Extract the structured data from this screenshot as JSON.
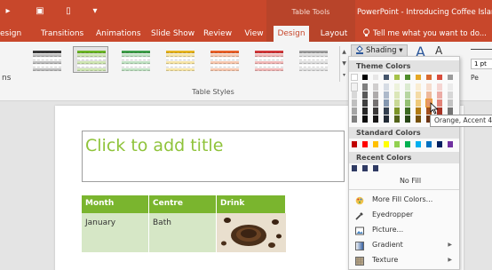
{
  "title_bar": {
    "context_label": "Table Tools",
    "window_title": "PowerPoint - Introducing Coffee Island.p",
    "tell_me": "Tell me what you want to do..."
  },
  "tabs": [
    {
      "label": "esign"
    },
    {
      "label": "Transitions"
    },
    {
      "label": "Animations"
    },
    {
      "label": "Slide Show"
    },
    {
      "label": "Review"
    },
    {
      "label": "View"
    },
    {
      "label": "Design",
      "active": true
    },
    {
      "label": "Layout"
    }
  ],
  "ribbon": {
    "left_cut_label": "ns",
    "group_label": "Table Styles",
    "shading_label": "Shading",
    "pt_value": "1 pt",
    "pen_label": "Pe",
    "table_style_swatches": [
      {
        "header": "#3a3a3a",
        "band": "#bdbdbd"
      },
      {
        "header": "#6bb526",
        "band": "#cfe6b2",
        "selected": true
      },
      {
        "header": "#3f9f4a",
        "band": "#bfe1c2"
      },
      {
        "header": "#e6b420",
        "band": "#f6e4a6"
      },
      {
        "header": "#e9612a",
        "band": "#f7c7ae"
      },
      {
        "header": "#d2383a",
        "band": "#f1b8b7"
      },
      {
        "header": "#a0a0a0",
        "band": "#dcdcdc"
      }
    ]
  },
  "dropdown": {
    "theme_colors_label": "Theme Colors",
    "standard_colors_label": "Standard Colors",
    "recent_colors_label": "Recent Colors",
    "no_fill": "No Fill",
    "tooltip": "Orange, Accent 4, L",
    "theme_top_row": [
      "#ffffff",
      "#000000",
      "#e7e6e6",
      "#44546a",
      "#a5c249",
      "#4f8c2b",
      "#e5a725",
      "#d8692f",
      "#d84c3c",
      "#9b9b9b"
    ],
    "theme_shades": [
      [
        "#f2f2f2",
        "#7f7f7f",
        "#d0cece",
        "#d6dce4",
        "#edf2dc",
        "#dbead0",
        "#faedd2",
        "#f6dccd",
        "#f5d5d2",
        "#ebebeb"
      ],
      [
        "#d8d8d8",
        "#595959",
        "#aeabab",
        "#adb9ca",
        "#dbe6b8",
        "#b7d5a1",
        "#f4dba6",
        "#eeb99b",
        "#ecaca5",
        "#d7d7d7"
      ],
      [
        "#bfbfbf",
        "#3f3f3f",
        "#757171",
        "#8497b0",
        "#c9d995",
        "#93c072",
        "#efc979",
        "#e5966a",
        "#e28378",
        "#c3c3c3"
      ],
      [
        "#a5a5a5",
        "#262626",
        "#3a3838",
        "#333f4f",
        "#7c9427",
        "#3b6920",
        "#b27b12",
        "#a24e1d",
        "#a63324",
        "#747474"
      ],
      [
        "#7f7f7f",
        "#0c0c0c",
        "#171616",
        "#222a35",
        "#53631a",
        "#274615",
        "#77520c",
        "#6c3414",
        "#6f2218",
        "#4d4d4d"
      ]
    ],
    "standard_colors": [
      "#c00000",
      "#ff0000",
      "#ffc000",
      "#ffff00",
      "#92d050",
      "#00b050",
      "#00b0f0",
      "#0070c0",
      "#002060",
      "#7030a0"
    ],
    "recent_colors": [
      "#2f3a63",
      "#2f3a63",
      "#2f3a63"
    ],
    "menu_items": [
      {
        "label": "More Fill Colors...",
        "icon": "palette-icon"
      },
      {
        "label": "Eyedropper",
        "icon": "eyedropper-icon"
      },
      {
        "label": "Picture...",
        "icon": "picture-icon"
      },
      {
        "label": "Gradient",
        "icon": "gradient-icon",
        "submenu": true
      },
      {
        "label": "Texture",
        "icon": "texture-icon",
        "submenu": true
      }
    ]
  },
  "slide": {
    "title_placeholder": "Click to add title",
    "table": {
      "headers": [
        "Month",
        "Centre",
        "Drink"
      ],
      "rows": [
        [
          "January",
          "Bath",
          ""
        ]
      ],
      "header_color": "#7ab52e",
      "row_color": "#d6e7c6"
    }
  }
}
